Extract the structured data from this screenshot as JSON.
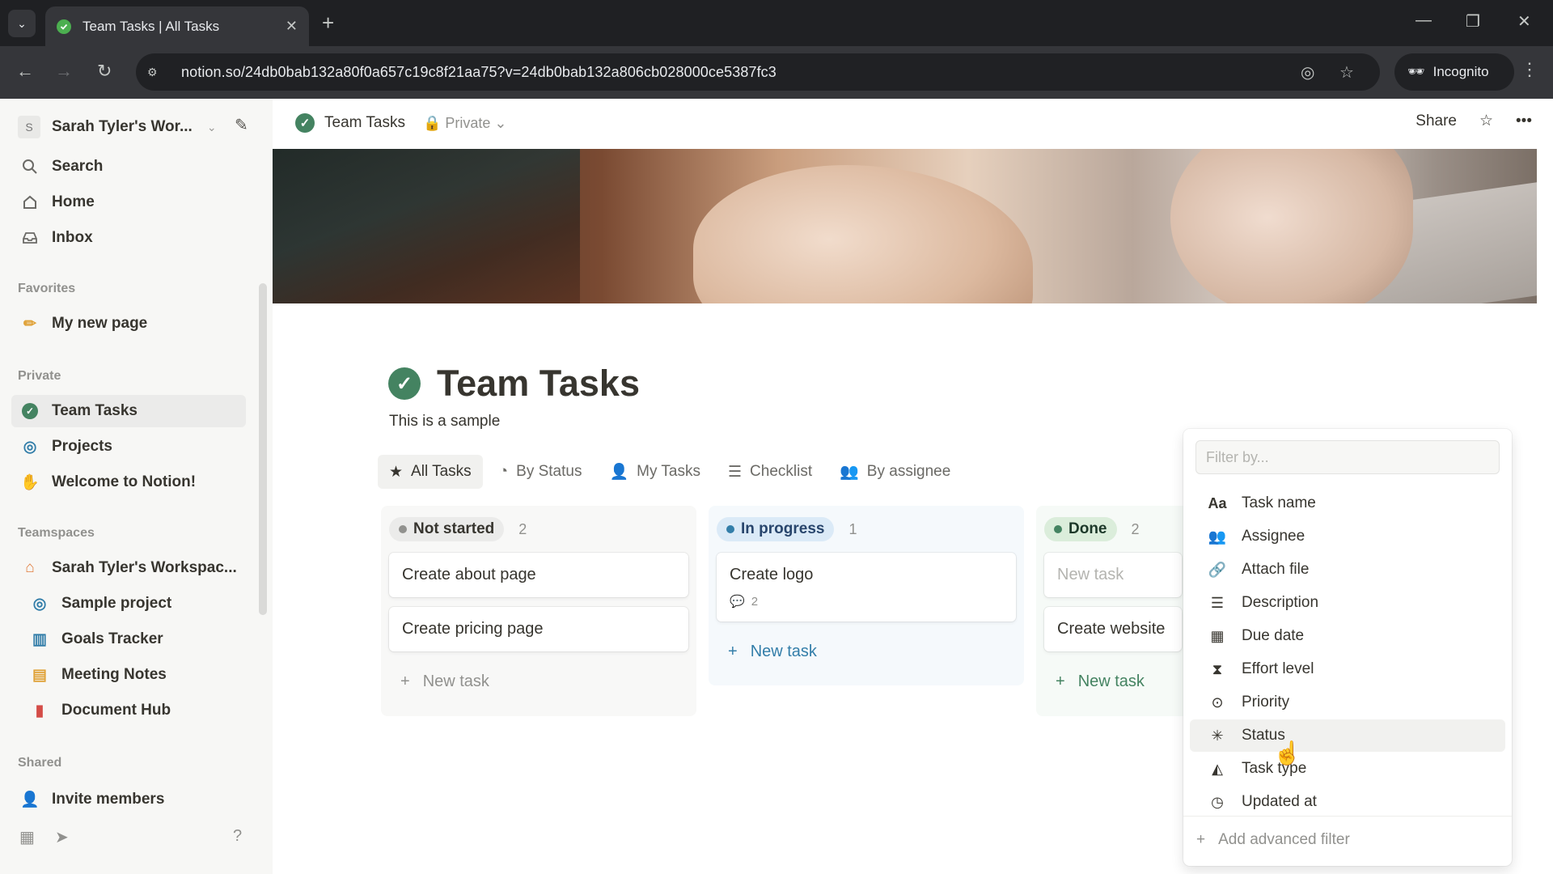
{
  "browser": {
    "tab_title": "Team Tasks | All Tasks",
    "url": "notion.so/24db0bab132a80f0a657c19c8f21aa75?v=24db0bab132a806cb028000ce5387fc3",
    "incognito_label": "Incognito"
  },
  "sidebar": {
    "workspace_avatar": "S",
    "workspace_name": "Sarah Tyler's Wor...",
    "top_items": [
      {
        "label": "Search",
        "icon": "search-icon"
      },
      {
        "label": "Home",
        "icon": "home-icon"
      },
      {
        "label": "Inbox",
        "icon": "inbox-icon"
      }
    ],
    "favorites_title": "Favorites",
    "favorites": [
      {
        "label": "My new page",
        "icon": "pencil-icon"
      }
    ],
    "private_title": "Private",
    "private": [
      {
        "label": "Team Tasks",
        "icon": "check-circle-icon"
      },
      {
        "label": "Projects",
        "icon": "target-icon"
      },
      {
        "label": "Welcome to Notion!",
        "icon": "wave-icon"
      }
    ],
    "teamspaces_title": "Teamspaces",
    "teamspaces": [
      {
        "label": "Sarah Tyler's Workspac...",
        "icon": "house-icon"
      },
      {
        "label": "Sample project",
        "icon": "target-icon"
      },
      {
        "label": "Goals Tracker",
        "icon": "chart-icon"
      },
      {
        "label": "Meeting Notes",
        "icon": "calendar-icon"
      },
      {
        "label": "Document Hub",
        "icon": "book-icon"
      }
    ],
    "shared_title": "Shared",
    "invite_label": "Invite members"
  },
  "topbar": {
    "breadcrumb": "Team Tasks",
    "privacy": "Private",
    "share_label": "Share"
  },
  "page": {
    "title": "Team Tasks",
    "description": "This is a sample",
    "views": [
      {
        "label": "All Tasks",
        "icon": "star-icon"
      },
      {
        "label": "By Status",
        "icon": "status-icon"
      },
      {
        "label": "My Tasks",
        "icon": "person-icon"
      },
      {
        "label": "Checklist",
        "icon": "checklist-icon"
      },
      {
        "label": "By assignee",
        "icon": "people-icon"
      }
    ]
  },
  "board": {
    "columns": [
      {
        "status": "Not started",
        "count": "2",
        "color": "#91918e",
        "pill_bg": "#ebebea",
        "cards": [
          "Create about page",
          "Create pricing page"
        ],
        "new_task": "New task"
      },
      {
        "status": "In progress",
        "count": "1",
        "color": "#337ea9",
        "pill_bg": "#dbeaf7",
        "cards": [
          "Create logo"
        ],
        "comment_count": "2",
        "new_task": "New task"
      },
      {
        "status": "Done",
        "count": "2",
        "color": "#448361",
        "pill_bg": "#dbeddb",
        "cards": [
          "New task",
          "Create website"
        ],
        "new_task": "New task"
      }
    ]
  },
  "filter_menu": {
    "placeholder": "Filter by...",
    "items": [
      {
        "label": "Task name",
        "icon": "text-icon"
      },
      {
        "label": "Assignee",
        "icon": "people-icon"
      },
      {
        "label": "Attach file",
        "icon": "paperclip-icon"
      },
      {
        "label": "Description",
        "icon": "lines-icon"
      },
      {
        "label": "Due date",
        "icon": "calendar-icon"
      },
      {
        "label": "Effort level",
        "icon": "hourglass-icon"
      },
      {
        "label": "Priority",
        "icon": "chevron-circle-icon"
      },
      {
        "label": "Status",
        "icon": "loader-icon"
      },
      {
        "label": "Task type",
        "icon": "shapes-icon"
      },
      {
        "label": "Updated at",
        "icon": "clock-icon"
      }
    ],
    "add_advanced": "Add advanced filter"
  }
}
